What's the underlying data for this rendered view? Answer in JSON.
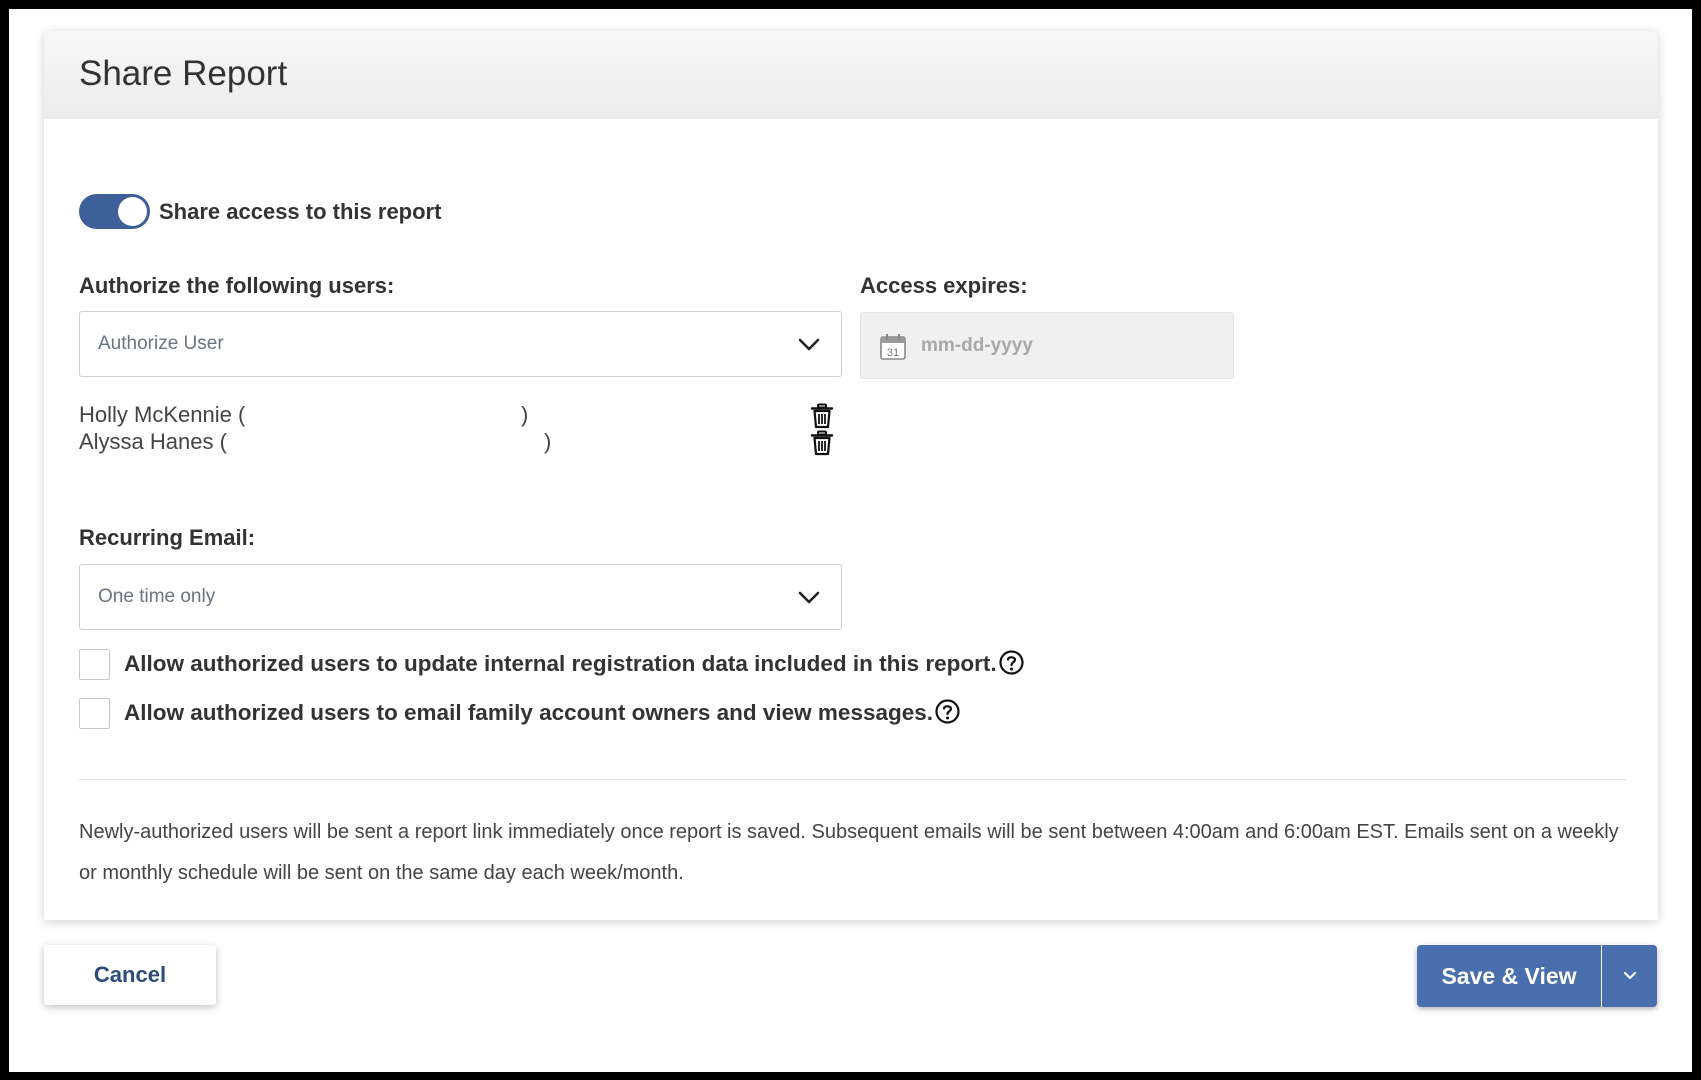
{
  "dialog": {
    "title": "Share Report"
  },
  "share_toggle": {
    "label": "Share access to this report",
    "enabled": true
  },
  "authorize": {
    "label": "Authorize the following users:",
    "select_value": "Authorize User",
    "icon": "chevron-down-icon"
  },
  "access_expires": {
    "label": "Access expires:",
    "placeholder": "mm-dd-yyyy",
    "icon": "calendar-icon",
    "icon_day": "31"
  },
  "users": [
    {
      "name": "Holly McKennie (",
      "close": ")"
    },
    {
      "name": "Alyssa Hanes (",
      "close": ")"
    }
  ],
  "recurring": {
    "label": "Recurring Email:",
    "select_value": "One time only"
  },
  "options": [
    {
      "label": "Allow authorized users to update internal registration data included in this report.",
      "checked": false
    },
    {
      "label": "Allow authorized users to email family account owners and view messages.",
      "checked": false
    }
  ],
  "note": "Newly-authorized users will be sent a report link immediately once report is saved. Subsequent emails will be sent between 4:00am and 6:00am EST. Emails sent on a weekly or monthly schedule will be sent on the same day each week/month.",
  "buttons": {
    "cancel": "Cancel",
    "save": "Save & View"
  },
  "colors": {
    "accent": "#4a6fae",
    "toggle": "#3d5f9a",
    "cancel_text": "#2c4a7c"
  }
}
